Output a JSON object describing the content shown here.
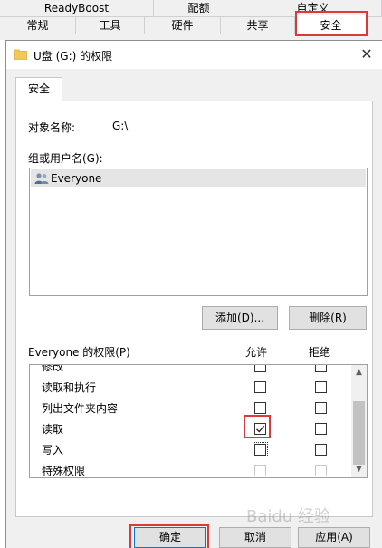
{
  "background_tabs": {
    "row1": [
      "ReadyBoost",
      "配额",
      "自定义"
    ],
    "row2": [
      "常规",
      "工具",
      "硬件",
      "共享",
      "安全"
    ]
  },
  "window": {
    "title": "U盘 (G:) 的权限",
    "close_icon": "close-icon",
    "tab": "安全",
    "object_name_label": "对象名称:",
    "object_name_value": "G:\\",
    "group_label": "组或用户名(G):",
    "users": [
      {
        "name": "Everyone",
        "icon": "users-icon",
        "selected": true
      }
    ],
    "add_button": "添加(D)...",
    "remove_button": "删除(R)",
    "permissions_label": "Everyone 的权限(P)",
    "allow_header": "允许",
    "deny_header": "拒绝",
    "permissions": [
      {
        "name": "修改",
        "allow": false,
        "deny": false,
        "disabled": false
      },
      {
        "name": "读取和执行",
        "allow": false,
        "deny": false,
        "disabled": false
      },
      {
        "name": "列出文件夹内容",
        "allow": false,
        "deny": false,
        "disabled": false
      },
      {
        "name": "读取",
        "allow": true,
        "deny": false,
        "disabled": false
      },
      {
        "name": "写入",
        "allow": false,
        "deny": false,
        "disabled": false
      },
      {
        "name": "特殊权限",
        "allow": false,
        "deny": false,
        "disabled": true
      }
    ],
    "ok_button": "确定",
    "cancel_button": "取消",
    "apply_button": "应用(A)"
  },
  "watermark": "Baidu 经验",
  "colors": {
    "highlight_red": "#d93a3a",
    "default_button_border": "#0078d7",
    "selected_row": "#e5e5e5"
  }
}
